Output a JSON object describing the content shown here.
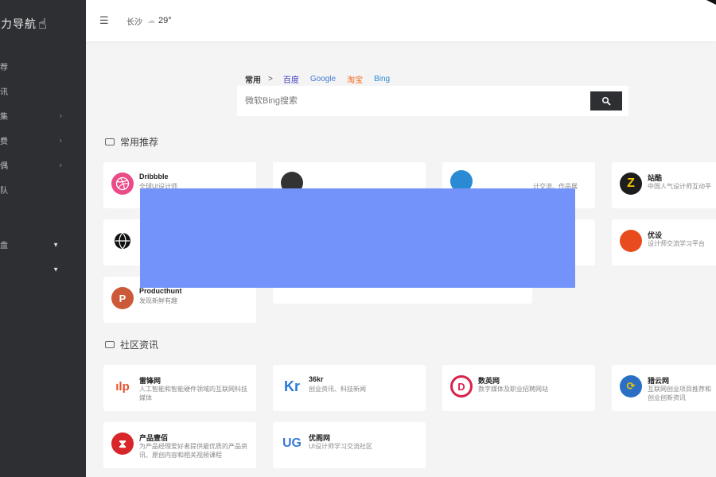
{
  "sidebar": {
    "logo_text": "一力导航",
    "items": [
      {
        "label": "荐",
        "arrow": ""
      },
      {
        "label": "讯",
        "arrow": ""
      },
      {
        "label": "集",
        "arrow": "›"
      },
      {
        "label": "费",
        "arrow": "›"
      },
      {
        "label": "偶",
        "arrow": "›"
      },
      {
        "label": "队",
        "arrow": ""
      },
      {
        "label": "",
        "arrow": ""
      },
      {
        "label": "",
        "arrow": ""
      },
      {
        "label": "盘",
        "arrow": "▼"
      },
      {
        "label": "",
        "arrow": "▼"
      }
    ]
  },
  "header": {
    "menu_icon": "menu-icon",
    "city": "长沙",
    "temp": "29°"
  },
  "search": {
    "group": "常用",
    "arrow": ">",
    "tabs": [
      {
        "label": "百度",
        "color": "#3b3bbf"
      },
      {
        "label": "Google",
        "color": "#4a7ad8"
      },
      {
        "label": "淘宝",
        "color": "#f06a1a"
      },
      {
        "label": "Bing",
        "color": "#2a8bd4"
      }
    ],
    "placeholder": "微软Bing搜索"
  },
  "sections": [
    {
      "title": "常用推荐"
    },
    {
      "title": "社区资讯"
    }
  ],
  "cards": {
    "dribbble": {
      "name": "Dribbble",
      "desc": "全球UI设计师",
      "color": "#ea4c89",
      "icon": "dribbble-icon"
    },
    "card2": {
      "name": "",
      "desc": "",
      "color": "#333333"
    },
    "card3": {
      "name": "",
      "desc": "计交流、作品展",
      "color": "#2a8bd4"
    },
    "zhanku": {
      "name": "站酷",
      "desc": "中国人气设计师互动平",
      "color": "#222222",
      "glyph": "Z"
    },
    "globe": {
      "name": "",
      "desc": "",
      "color": "#111111",
      "icon": "globe-icon"
    },
    "youshe": {
      "name": "优设",
      "desc": "设计师交流学习平台",
      "color": "#e84b1e"
    },
    "producthunt": {
      "name": "Producthunt",
      "desc": "发现新鲜有趣",
      "color": "#cc5a38",
      "glyph": "P"
    },
    "leifeng": {
      "name": "雷锋网",
      "desc": "人工智能和智能硬件领域的互联网科技媒体",
      "color": "#e8512a",
      "glyph": "ılp"
    },
    "36kr": {
      "name": "36kr",
      "desc": "创业资讯、科技新闻",
      "color": "#2a7ad8",
      "glyph": "Kr"
    },
    "shumeiwang": {
      "name": "数英网",
      "desc": "数字媒体及职业招聘网站",
      "color": "#d8234a",
      "glyph": "D"
    },
    "lieyun": {
      "name": "猎云网",
      "desc": "互联网创业项目推荐和创业创新资讯",
      "color": "#2a6fc4",
      "glyph": "⟳"
    },
    "chanpin": {
      "name": "产品壹佰",
      "desc": "为产品经理爱好者提供最优质的产品资讯、原创内容和相关视频课程",
      "color": "#d8262a",
      "glyph": "⧗"
    },
    "youyan": {
      "name": "优阁网",
      "desc": "UI设计师学习交流社区",
      "color": "#3a7ad8",
      "glyph": "UG"
    }
  },
  "overlay_color": "#7393fa"
}
